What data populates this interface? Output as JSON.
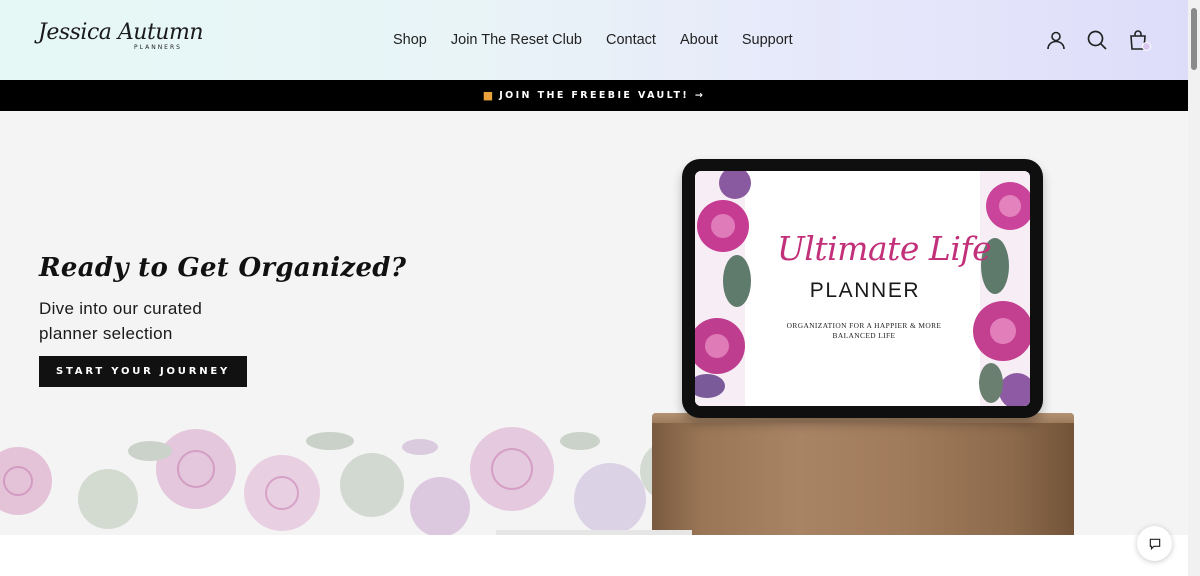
{
  "brand": {
    "logo_script": "Jessica Autumn",
    "logo_sub": "PLANNERS"
  },
  "nav": {
    "items": [
      {
        "label": "Shop"
      },
      {
        "label": "Join The Reset Club"
      },
      {
        "label": "Contact"
      },
      {
        "label": "About"
      },
      {
        "label": "Support"
      }
    ]
  },
  "header_icons": [
    "account-icon",
    "search-icon",
    "cart-icon"
  ],
  "announcement": {
    "icon": "gift-icon",
    "text": "JOIN THE FREEBIE VAULT! →"
  },
  "hero": {
    "title": "Ready to Get Organized?",
    "subtitle": "Dive into our curated planner selection",
    "cta_label": "START YOUR JOURNEY"
  },
  "tablet_screen": {
    "script_title": "Ultimate Life",
    "title": "PLANNER",
    "tagline": "ORGANIZATION FOR A HAPPIER & MORE BALANCED LIFE"
  },
  "colors": {
    "accent_pink": "#c2307a",
    "announce_bg": "#000000",
    "gift": "#e9a23b"
  }
}
